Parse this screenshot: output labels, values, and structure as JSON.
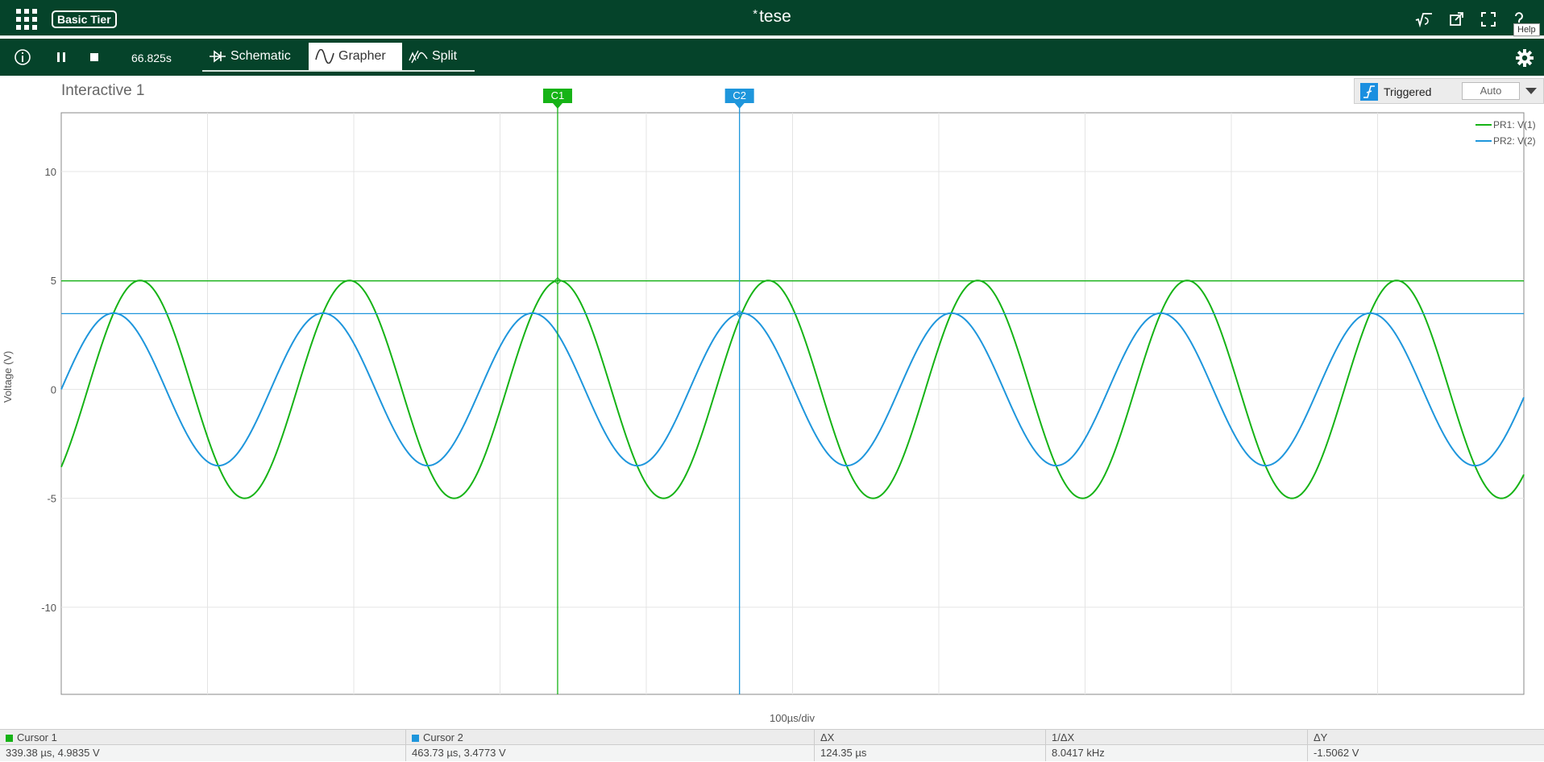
{
  "app": {
    "tier_label": "Basic Tier",
    "title_mark": "*",
    "title": "tese",
    "help_tooltip": "Help"
  },
  "toolbar": {
    "sim_time": "66.825s",
    "tabs": [
      {
        "label": "Schematic",
        "active": false
      },
      {
        "label": "Grapher",
        "active": true
      },
      {
        "label": "Split",
        "active": false
      }
    ]
  },
  "panel": {
    "title": "Interactive 1",
    "trigger_label": "Triggered",
    "trigger_mode": "Auto"
  },
  "chart_data": {
    "type": "line",
    "ylabel": "Voltage (V)",
    "xlabel": "100µs/div",
    "ylim": [
      -14.0,
      12.7
    ],
    "yticks": [
      10,
      5,
      0,
      -5,
      -10
    ],
    "xlim_us": [
      0,
      1000
    ],
    "grid": true,
    "legend_position": "top-right",
    "series": [
      {
        "name": "PR1: V(1)",
        "color": "#16b316",
        "amplitude": 5.0,
        "period_us": 143.2,
        "phase_deg": -45.4
      },
      {
        "name": "PR2: V(2)",
        "color": "#1e96dc",
        "amplitude": 3.5,
        "period_us": 143.2,
        "phase_deg": 0
      }
    ],
    "cursors": [
      {
        "label": "C1",
        "x_us": 339.38,
        "y": 4.9835,
        "color": "#16b316"
      },
      {
        "label": "C2",
        "x_us": 463.73,
        "y": 3.4773,
        "color": "#1e96dc"
      }
    ]
  },
  "cursor_table": {
    "headers": [
      "Cursor 1",
      "Cursor 2",
      "ΔX",
      "1/ΔX",
      "ΔY"
    ],
    "values": [
      "339.38 µs, 4.9835 V",
      "463.73 µs, 3.4773 V",
      "124.35 µs",
      "8.0417 kHz",
      "-1.5062 V"
    ],
    "swatch_colors": [
      "#16b316",
      "#1e96dc"
    ]
  }
}
